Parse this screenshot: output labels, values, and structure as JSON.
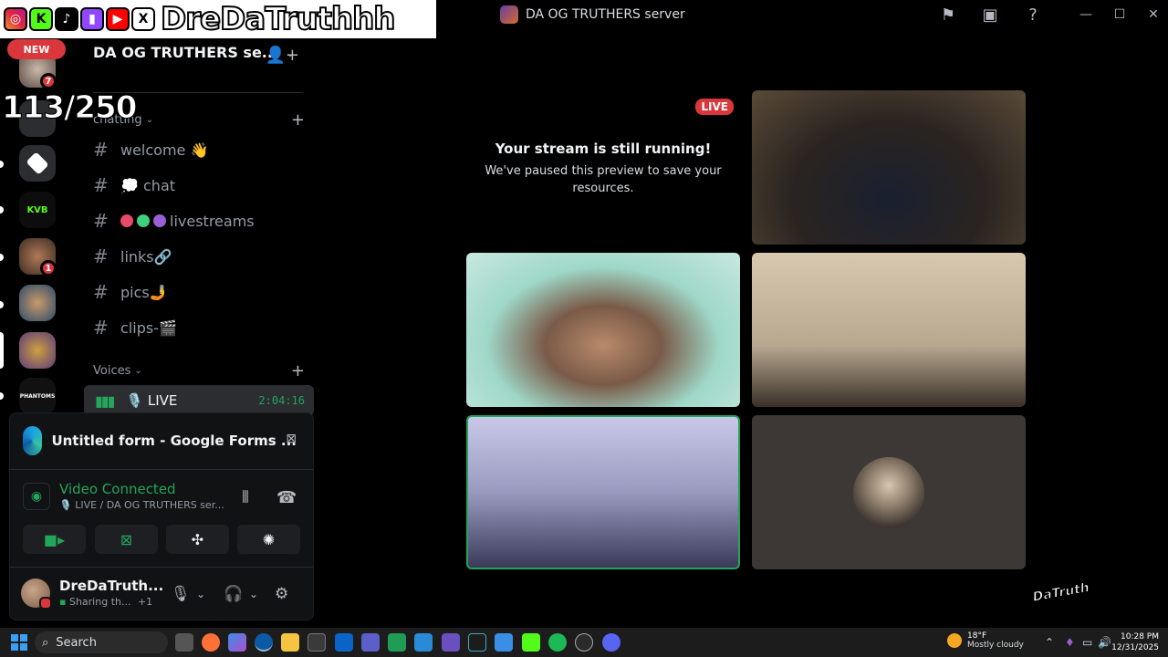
{
  "overlay": {
    "name": "DreDaTruthhh",
    "social_icons": [
      "instagram-icon",
      "kick-icon",
      "tiktok-icon",
      "twitch-icon",
      "youtube-icon",
      "x-icon"
    ],
    "counter": "113/250"
  },
  "titlebar": {
    "server_title": "DA OG TRUTHERS server"
  },
  "rail": {
    "new_label": "NEW",
    "badges": {
      "server1": "7",
      "server4": "1"
    }
  },
  "server": {
    "name": "DA OG TRUTHERS se...",
    "categories": {
      "chatting": "chatting",
      "voices": "Voices"
    },
    "channels": [
      {
        "label": "welcome 👋"
      },
      {
        "label": "💭 chat"
      },
      {
        "label": "livestreams"
      },
      {
        "label": "links🔗"
      },
      {
        "label": "pics🤳"
      },
      {
        "label": "clips-🎬"
      }
    ],
    "voice_channel": {
      "label": "🎙️ LIVE",
      "timer": "2:04:16"
    }
  },
  "panel": {
    "form_title": "Untitled form - Google Forms ...",
    "vc_title": "Video Connected",
    "vc_sub": "🎙️ LIVE / DA OG TRUTHERS ser...",
    "user_name": "DreDaTruth...",
    "user_sub": "Sharing th...",
    "user_sub_extra": "+1"
  },
  "stream": {
    "live_label": "LIVE",
    "paused_title": "Your stream is still running!",
    "paused_sub": "We've paused this preview to save your resources."
  },
  "watermark": "DaTruth",
  "taskbar": {
    "search_label": "Search",
    "weather_temp": "18°F",
    "weather_desc": "Mostly cloudy",
    "time": "10:28 PM",
    "date": "12/31/2025"
  },
  "colors": {
    "accent_green": "#23a55a",
    "danger_red": "#da373c",
    "background": "#000000"
  }
}
